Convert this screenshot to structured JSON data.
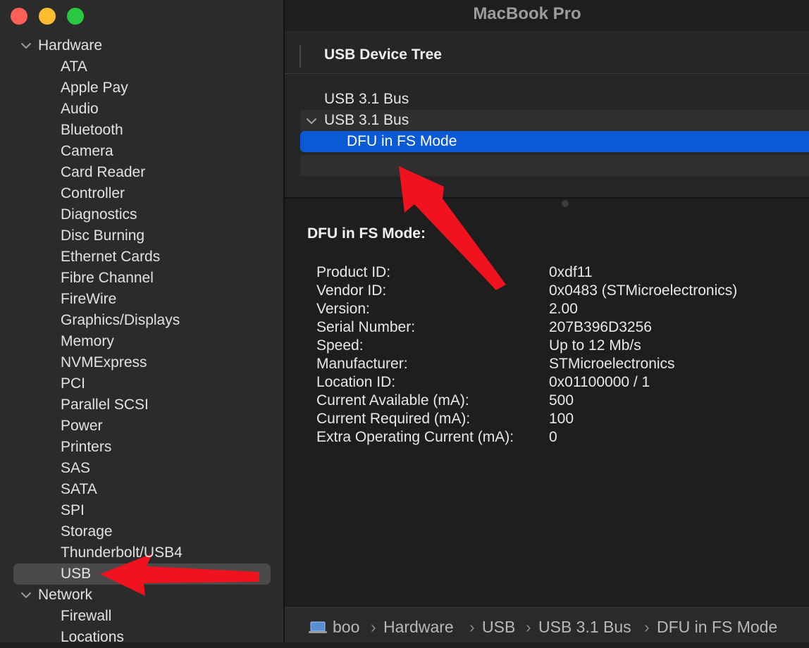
{
  "window": {
    "title": "MacBook Pro",
    "buttons": [
      "close",
      "minimize",
      "zoom"
    ]
  },
  "sidebar": {
    "groups": [
      {
        "label": "Hardware",
        "expanded": true,
        "items": [
          "ATA",
          "Apple Pay",
          "Audio",
          "Bluetooth",
          "Camera",
          "Card Reader",
          "Controller",
          "Diagnostics",
          "Disc Burning",
          "Ethernet Cards",
          "Fibre Channel",
          "FireWire",
          "Graphics/Displays",
          "Memory",
          "NVMExpress",
          "PCI",
          "Parallel SCSI",
          "Power",
          "Printers",
          "SAS",
          "SATA",
          "SPI",
          "Storage",
          "Thunderbolt/USB4",
          "USB"
        ]
      },
      {
        "label": "Network",
        "expanded": true,
        "items": [
          "Firewall",
          "Locations"
        ]
      }
    ],
    "selected": "USB"
  },
  "tree": {
    "header": "USB Device Tree",
    "rows": [
      {
        "label": "USB 3.1 Bus",
        "level": 0,
        "expandable": false
      },
      {
        "label": "USB 3.1 Bus",
        "level": 0,
        "expandable": true,
        "expanded": true
      },
      {
        "label": "DFU in FS Mode",
        "level": 1,
        "selected": true
      }
    ]
  },
  "detail": {
    "title": "DFU in FS Mode:",
    "properties": [
      {
        "key": "Product ID:",
        "value": "0xdf11"
      },
      {
        "key": "Vendor ID:",
        "value": "0x0483  (STMicroelectronics)"
      },
      {
        "key": "Version:",
        "value": "2.00"
      },
      {
        "key": "Serial Number:",
        "value": "207B396D3256"
      },
      {
        "key": "Speed:",
        "value": "Up to 12 Mb/s"
      },
      {
        "key": "Manufacturer:",
        "value": "STMicroelectronics"
      },
      {
        "key": "Location ID:",
        "value": "0x01100000 / 1"
      },
      {
        "key": "Current Available (mA):",
        "value": "500"
      },
      {
        "key": "Current Required (mA):",
        "value": "100"
      },
      {
        "key": "Extra Operating Current (mA):",
        "value": "0"
      }
    ]
  },
  "pathbar": {
    "icon": "laptop-icon",
    "segments": [
      "boo",
      "Hardware",
      "USB",
      "USB 3.1 Bus",
      "DFU in FS Mode"
    ],
    "separator": "›"
  },
  "annotations": {
    "arrow_color": "#f0121e"
  },
  "colors": {
    "selection": "#0a5ad6",
    "sidebar_bg": "#2b2b2b",
    "main_bg": "#1e1e1e"
  }
}
